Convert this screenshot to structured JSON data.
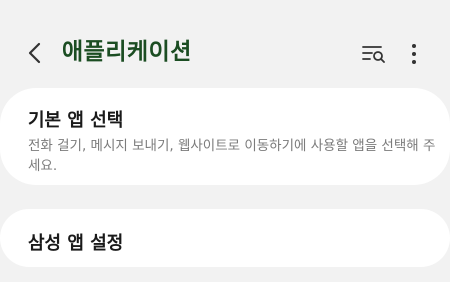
{
  "header": {
    "title": "애플리케이션",
    "back_icon": "chevron-left-icon",
    "search_icon": "list-search-icon",
    "more_icon": "more-vertical-icon"
  },
  "items": [
    {
      "title": "기본 앱 선택",
      "description": "전화 걸기, 메시지 보내기, 웹사이트로 이동하기에 사용할 앱을 선택해 주세요."
    },
    {
      "title": "삼성 앱 설정"
    }
  ],
  "colors": {
    "background": "#f2f2f2",
    "card": "#ffffff",
    "title_accent": "#1b4d22",
    "description": "#7b7b7b"
  }
}
